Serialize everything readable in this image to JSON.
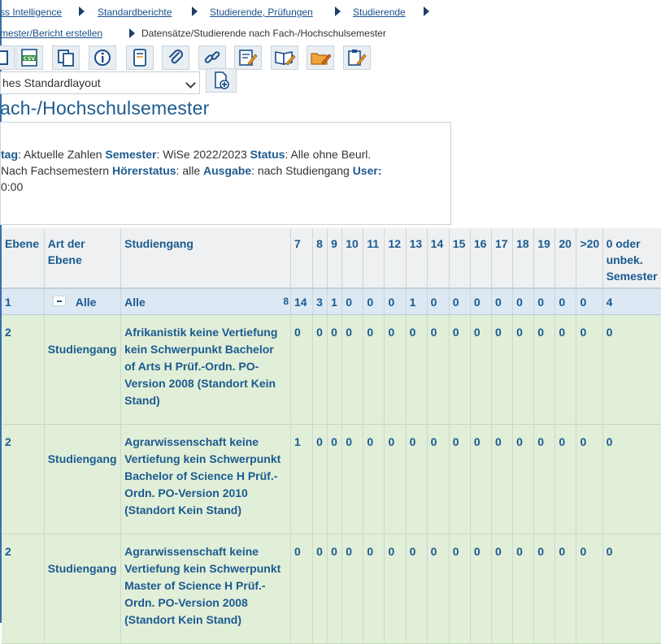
{
  "breadcrumb_top": [
    "ss Intelligence",
    "Standardberichte",
    "Studierende, Prüfungen",
    "Studierende"
  ],
  "breadcrumb_second": {
    "link": "mester/Bericht erstellen",
    "current": "Datensätze/Studierende nach Fach-/Hochschulsemester"
  },
  "toolbar_icons": [
    "export-icon",
    "csv-icon",
    "copy-icon",
    "info-icon",
    "notebook-icon",
    "attachment-icon",
    "link-icon",
    "edit-report-icon",
    "book-edit-icon",
    "folder-edit-icon",
    "clipboard-edit-icon"
  ],
  "toolbar_csv_text": "CSV",
  "layout_select": {
    "value": "hes Standardlayout"
  },
  "page_title": "ach-/Hochschulsemester",
  "params": {
    "line1": [
      {
        "label": "tag",
        "value": ": Aktuelle Zahlen  "
      },
      {
        "label": "Semester",
        "value": ": WiSe 2022/2023  "
      },
      {
        "label": "Status",
        "value": ": Alle ohne Beurl."
      }
    ],
    "line2_prefix": " Nach Fachsemestern  ",
    "line2": [
      {
        "label": "Hörerstatus",
        "value": ": alle  "
      },
      {
        "label": "Ausgabe",
        "value": ": nach Studiengang  "
      },
      {
        "label": "User:",
        "value": ""
      }
    ],
    "line3": "0:00"
  },
  "table": {
    "headers": {
      "ebene": "Ebene",
      "art": "Art der Ebene",
      "studiengang": "Studiengang",
      "semesters": [
        "7",
        "8",
        "9",
        "10",
        "11",
        "12",
        "13",
        "14",
        "15",
        "16",
        "17",
        "18",
        "19",
        "20",
        ">20",
        "0 oder unbek. Semester"
      ]
    },
    "total_row": {
      "ebene": "1",
      "art": "Alle",
      "studiengang": "Alle",
      "cut_value": "8",
      "values": [
        "14",
        "3",
        "1",
        "0",
        "0",
        "0",
        "1",
        "0",
        "0",
        "0",
        "0",
        "0",
        "0",
        "0",
        "0",
        "4"
      ]
    },
    "rows": [
      {
        "ebene": "2",
        "art": "Studiengang",
        "studiengang": "Afrikanistik keine Vertiefung kein Schwerpunkt Bachelor of Arts H Prüf.-Ordn. PO-Version 2008 (Standort Kein Stand)",
        "values": [
          "0",
          "0",
          "0",
          "0",
          "0",
          "0",
          "0",
          "0",
          "0",
          "0",
          "0",
          "0",
          "0",
          "0",
          "0",
          "0"
        ]
      },
      {
        "ebene": "2",
        "art": "Studiengang",
        "studiengang": "Agrarwissenschaft keine Vertiefung kein Schwerpunkt Bachelor of Science H Prüf.-Ordn. PO-Version 2010 (Standort Kein Stand)",
        "values": [
          "1",
          "0",
          "0",
          "0",
          "0",
          "0",
          "0",
          "0",
          "0",
          "0",
          "0",
          "0",
          "0",
          "0",
          "0",
          "0"
        ]
      },
      {
        "ebene": "2",
        "art": "Studiengang",
        "studiengang": "Agrarwissenschaft keine Vertiefung kein Schwerpunkt Master of Science H Prüf.-Ordn. PO-Version 2008 (Standort Kein Stand)",
        "values": [
          "0",
          "0",
          "0",
          "0",
          "0",
          "0",
          "0",
          "0",
          "0",
          "0",
          "0",
          "0",
          "0",
          "0",
          "0",
          "0"
        ]
      }
    ]
  }
}
